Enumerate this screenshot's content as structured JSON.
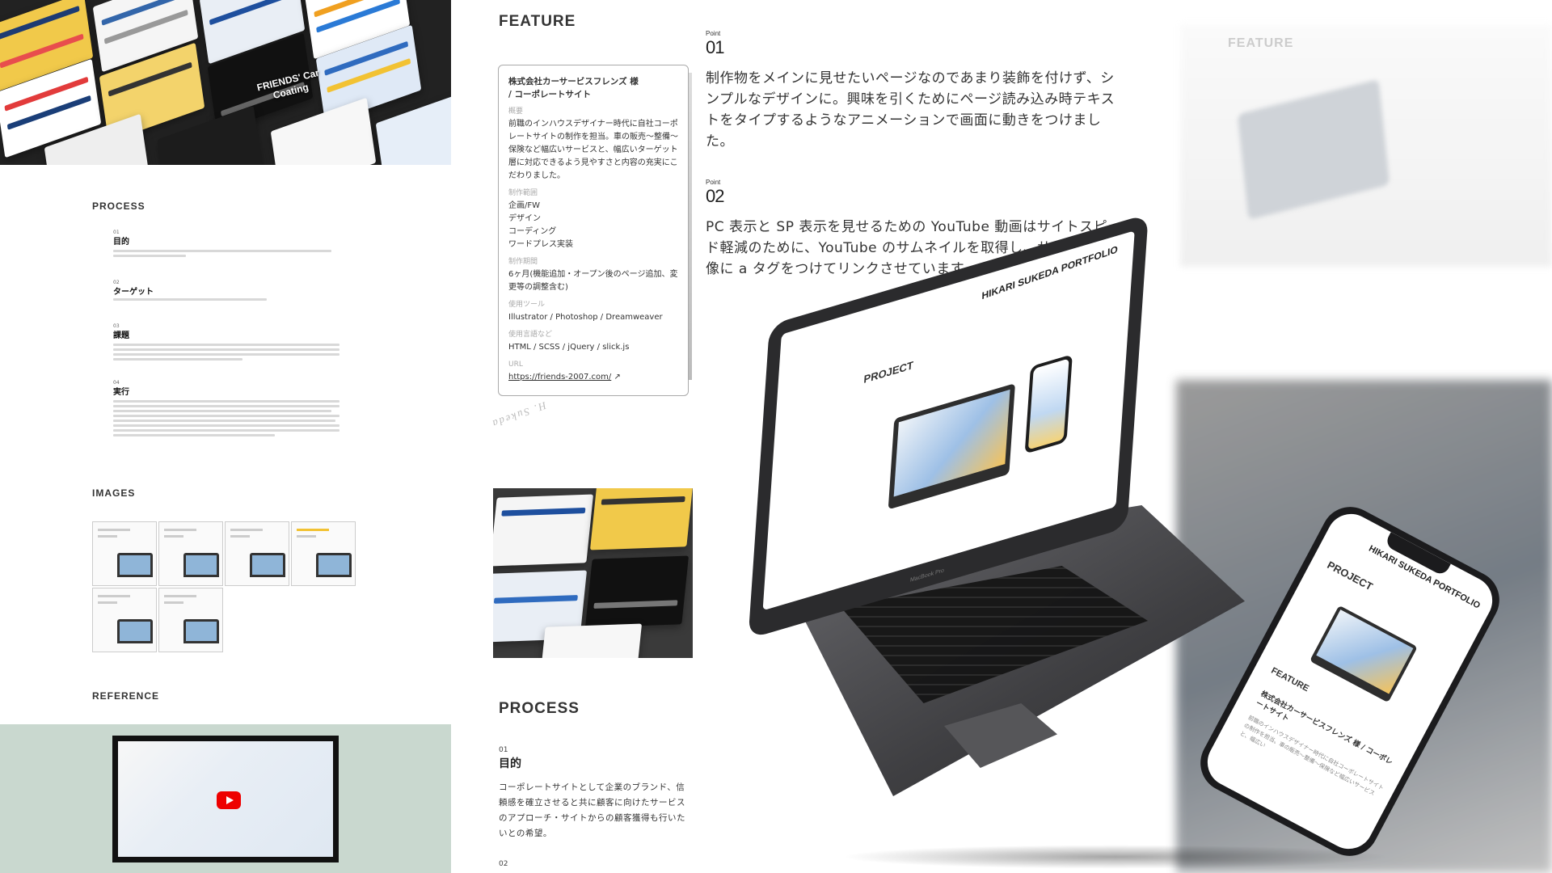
{
  "left": {
    "process_title": "PROCESS",
    "process_items": [
      {
        "num": "01",
        "head": "目的",
        "text": "コーポレートサイトとして企業のブランド、信頼感を確立させると共に顧客に向けたサービスのアプローチ・サイトからの顧客獲得も行いたいとの希望。"
      },
      {
        "num": "02",
        "head": "ターゲット",
        "text": ""
      },
      {
        "num": "03",
        "head": "課題",
        "text": ""
      },
      {
        "num": "04",
        "head": "実行",
        "text": ""
      }
    ],
    "images_title": "IMAGES",
    "reference_title": "REFERENCE",
    "hero_badge": "FRIENDS' Car Coating",
    "colors": {
      "reference_bg": "#c9d8cf",
      "accent_red": "#e00000"
    }
  },
  "middle": {
    "feature_title": "FEATURE",
    "card": {
      "title_line1": "株式会社カーサービスフレンズ 様",
      "title_line2": "/ コーポレートサイト",
      "overview_label": "概要",
      "overview_text": "前職のインハウスデザイナー時代に自社コーポレートサイトの制作を担当。車の販売〜整備〜保険など幅広いサービスと、幅広いターゲット層に対応できるよう見やすさと内容の充実にこだわりました。",
      "scope_label": "制作範囲",
      "scope_items": [
        "企画/FW",
        "デザイン",
        "コーディング",
        "ワードプレス実装"
      ],
      "period_label": "制作期間",
      "period_text": "6ヶ月(機能追加・オープン後のページ追加、変更等の調整含む)",
      "tools_label": "使用ツール",
      "tools_text": "Illustrator / Photoshop / Dreamweaver",
      "langs_label": "使用言語など",
      "langs_text": "HTML / SCSS / jQuery / slick.js",
      "url_label": "URL",
      "url_text": "https://friends-2007.com/"
    },
    "stamp": "H. Sukeda",
    "process_title": "PROCESS",
    "process_01_num": "01",
    "process_01_head": "目的",
    "process_01_text": "コーポレートサイトとして企業のブランド、信頼感を確立させると共に顧客に向けたサービスのアプローチ・サイトからの顧客獲得も行いたいとの希望。",
    "process_02_num": "02"
  },
  "right": {
    "point_label": "Point",
    "points": [
      {
        "num": "01",
        "text": "制作物をメインに見せたいページなのであまり装飾を付けず、シンプルなデザインに。興味を引くためにページ読み込み時テキストをタイプするようなアニメーションで画面に動きをつけました。"
      },
      {
        "num": "02",
        "text": "PC 表示と SP 表示を見せるための YouTube 動画はサイトスピード軽減のために、YouTube のサムネイルを取得し、サムネイル画像に a タグをつけてリンクさせています。"
      }
    ],
    "bg_feature": "FEATURE",
    "macbook": {
      "brand": "HIKARI SUKEDA PORTFOLIO",
      "project": "PROJECT",
      "label": "MacBook Pro"
    },
    "iphone": {
      "brand": "HIKARI SUKEDA PORTFOLIO",
      "project": "PROJECT",
      "feature": "FEATURE",
      "company": "株式会社カーサービスフレンズ 様 / コーポレートサイト",
      "text": "前職のインハウスデザイナー時代に自社コーポレートサイトの制作を担当。車の販売〜整備〜保険など幅広いサービスと、幅広い"
    }
  }
}
